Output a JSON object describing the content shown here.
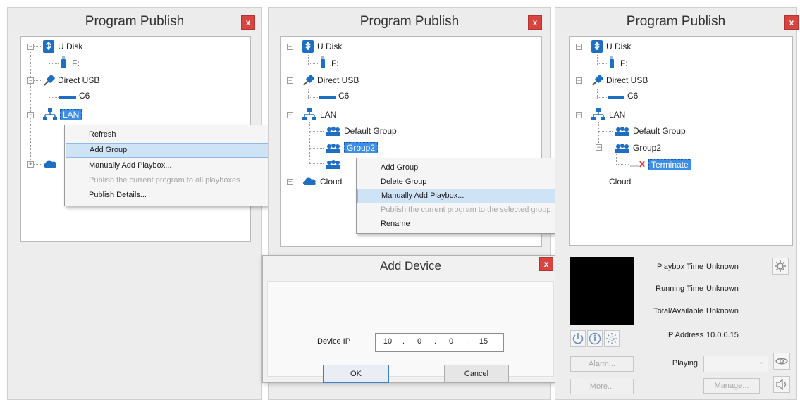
{
  "panels": [
    {
      "title": "Program Publish",
      "close": "x",
      "tree": {
        "udisk": "U Disk",
        "drive": "F:",
        "direct_usb": "Direct USB",
        "usb_device": "C6",
        "lan": "LAN"
      },
      "menu": [
        "Refresh",
        "Add Group",
        "Manually Add Playbox...",
        "Publish the current program to all playboxes",
        "Publish Details..."
      ]
    },
    {
      "title": "Program Publish",
      "close": "x",
      "tree": {
        "udisk": "U Disk",
        "drive": "F:",
        "direct_usb": "Direct USB",
        "usb_device": "C6",
        "lan": "LAN",
        "default_group": "Default Group",
        "group2": "Group2",
        "cloud": "Cloud"
      },
      "menu": [
        "Add Group",
        "Delete Group",
        "Manually Add Playbox...",
        "Publish the current program to the selected group",
        "Rename"
      ]
    },
    {
      "title": "Program Publish",
      "close": "x",
      "tree": {
        "udisk": "U Disk",
        "drive": "F:",
        "direct_usb": "Direct USB",
        "usb_device": "C6",
        "lan": "LAN",
        "default_group": "Default Group",
        "group2": "Group2",
        "terminate": "Terminate",
        "cloud": "Cloud"
      },
      "info": {
        "playbox_time_label": "Playbox Time",
        "playbox_time": "Unknown",
        "running_time_label": "Running Time",
        "running_time": "Unknown",
        "total_available_label": "Total/Available",
        "total_available": "Unknown",
        "ip_label": "IP Address",
        "ip": "10.0.0.15",
        "playing_label": "Playing",
        "playing_value": ""
      },
      "buttons": {
        "alarm": "Alarm...",
        "more": "More...",
        "manage": "Manage..."
      }
    }
  ],
  "dialog": {
    "title": "Add Device",
    "close": "x",
    "ip_label": "Device IP",
    "ip": [
      "10",
      "0",
      "0",
      "15"
    ],
    "ok": "OK",
    "cancel": "Cancel"
  },
  "colors": {
    "selection": "#3d8ee6",
    "close_button": "#d84541",
    "menu_highlight": "#cfe3f7",
    "icon_blue": "#1e6fc4"
  },
  "icons": {
    "usb_drive": "usb-drive-icon",
    "flash_drive": "flash-drive-icon",
    "usb_plug": "usb-plug-icon",
    "device": "device-icon",
    "network": "network-icon",
    "group": "group-icon",
    "cloud": "cloud-icon",
    "terminal_disconnected": "disconnected-terminal-icon",
    "power": "power-icon",
    "info": "info-icon",
    "brightness": "brightness-icon",
    "settings": "settings-icon",
    "eye": "eye-icon",
    "volume": "volume-icon"
  }
}
